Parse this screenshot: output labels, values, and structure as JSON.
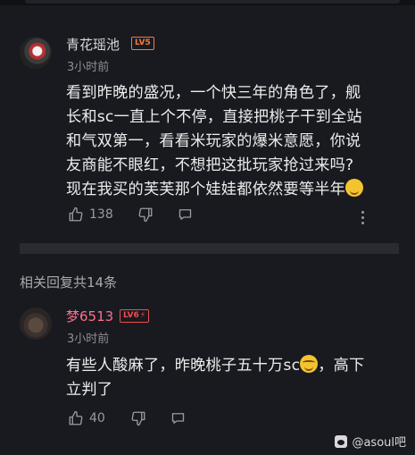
{
  "comments": [
    {
      "username": "青花瑶池",
      "level": "LV5",
      "time": "3小时前",
      "content_lines": [
        "看到昨晚的盛况，一个快三年的角色了，舰",
        "长和sc一直上个不停，直接把桃子干到全站",
        "和气双第一，看看米玩家的爆米意愿，你说",
        "友商能不眼红，不想把这批玩家抢过来吗?",
        "现在我买的芙芙那个娃娃都依然要等半年"
      ],
      "like_count": "138"
    },
    {
      "username": "梦6513",
      "level": "LV6",
      "time": "3小时前",
      "content_line1_part1": "有些人酸麻了，昨晚桃子五十万sc",
      "content_line1_part2": "，高下",
      "content_line2": "立判了",
      "like_count": "40"
    }
  ],
  "replies_header": "相关回复共14条",
  "watermark": "@asoul吧",
  "colors": {
    "background": "#191a1f",
    "text": "#ececec",
    "muted": "#8d8e93",
    "level_orange": "#f07b3f",
    "level_red": "#ef4d4d",
    "pink_username": "#ff6f8e"
  },
  "icons": [
    "thumbs-up-icon",
    "thumbs-down-icon",
    "reply-bubble-icon",
    "more-vertical-icon",
    "weary-emoji-icon",
    "laughing-tears-emoji-icon",
    "tieba-paw-icon"
  ]
}
